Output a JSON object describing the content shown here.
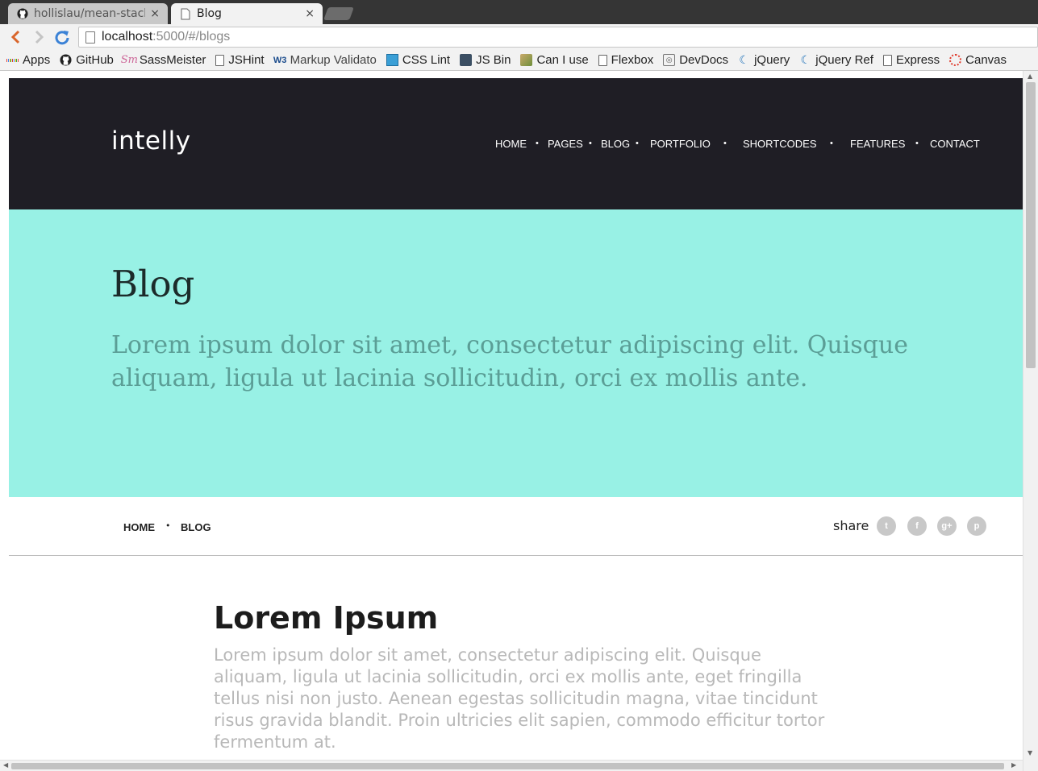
{
  "browser": {
    "tabs": [
      {
        "title": "hollislau/mean-stack",
        "icon": "github-icon",
        "active": false
      },
      {
        "title": "Blog",
        "icon": "page-icon",
        "active": true
      }
    ],
    "close_glyph": "×",
    "address": {
      "host": "localhost",
      "path": ":5000/#/blogs"
    },
    "bookmarks": [
      {
        "label": "Apps",
        "icon": "apps-grid-icon"
      },
      {
        "label": "GitHub",
        "icon": "github-icon"
      },
      {
        "label": "SassMeister",
        "icon": "sassmeister-icon"
      },
      {
        "label": "JSHint",
        "icon": "page-icon"
      },
      {
        "label": "Markup Validato",
        "icon": "w3c-icon"
      },
      {
        "label": "CSS Lint",
        "icon": "csslint-icon"
      },
      {
        "label": "JS Bin",
        "icon": "jsbin-icon"
      },
      {
        "label": "Can I use",
        "icon": "caniuse-icon"
      },
      {
        "label": "Flexbox",
        "icon": "page-icon"
      },
      {
        "label": "DevDocs",
        "icon": "devdocs-icon"
      },
      {
        "label": "jQuery",
        "icon": "jquery-icon"
      },
      {
        "label": "jQuery Ref",
        "icon": "jquery-icon"
      },
      {
        "label": "Express",
        "icon": "page-icon"
      },
      {
        "label": "Canvas",
        "icon": "canvas-icon"
      }
    ]
  },
  "site": {
    "logo": "intelly",
    "nav": [
      "HOME",
      "PAGES",
      "BLOG",
      "PORTFOLIO",
      "SHORTCODES",
      "FEATURES",
      "CONTACT"
    ],
    "nav_separator": "•",
    "hero": {
      "title": "Blog",
      "text": "Lorem ipsum dolor sit amet, consectetur adipiscing elit. Quisque aliquam, ligula ut lacinia sollicitudin, orci ex mollis ante."
    },
    "breadcrumb": [
      "HOME",
      "BLOG"
    ],
    "share": {
      "label": "share",
      "buttons": [
        {
          "name": "twitter",
          "glyph": "t"
        },
        {
          "name": "facebook",
          "glyph": "f"
        },
        {
          "name": "google-plus",
          "glyph": "g+"
        },
        {
          "name": "pinterest",
          "glyph": "p"
        }
      ]
    },
    "article": {
      "title": "Lorem Ipsum",
      "text": "Lorem ipsum dolor sit amet, consectetur adipiscing elit. Quisque aliquam, ligula ut lacinia sollicitudin, orci ex mollis ante, eget fringilla tellus nisi non justo. Aenean egestas sollicitudin magna, vitae tincidunt risus gravida blandit. Proin ultricies elit sapien, commodo efficitur tortor fermentum at."
    }
  },
  "colors": {
    "header_bg": "#1f1e25",
    "hero_bg": "#98f1e5",
    "hero_text": "#5b9e96",
    "article_text": "#b8b8b8"
  }
}
